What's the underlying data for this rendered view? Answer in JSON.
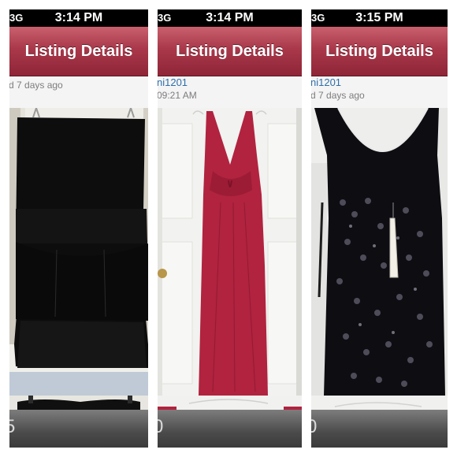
{
  "screens": [
    {
      "status": {
        "carrier": "3G",
        "time": "3:14 PM"
      },
      "title": "Listing Details",
      "meta": {
        "sub": "d 7 days ago"
      },
      "price_partial": "5",
      "photo_alt": "Black strapless peplum romper on a white door"
    },
    {
      "status": {
        "carrier": "3G",
        "time": "3:14 PM"
      },
      "title": "Listing Details",
      "meta": {
        "user": "ni1201",
        "sub": "09:21 AM"
      },
      "price_partial": "0",
      "photo_alt": "Red sleeveless maxi dress hanging on a white door"
    },
    {
      "status": {
        "carrier": "3G",
        "time": "3:15 PM"
      },
      "title": "Listing Details",
      "meta": {
        "user": "ni1201",
        "sub": "d 7 days ago"
      },
      "price_partial": "0",
      "photo_alt": "Black sequin tank dress with tags"
    }
  ],
  "colors": {
    "nav": "#a9384a",
    "link": "#2f6ea9",
    "gray_text": "#7d7d7d"
  }
}
